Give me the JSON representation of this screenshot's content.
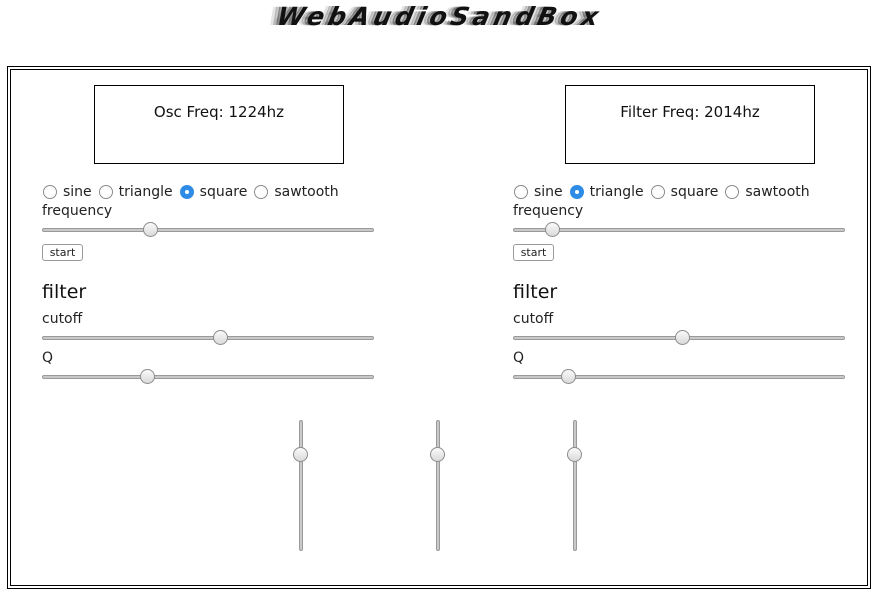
{
  "title": "WebAudioSandBox",
  "left": {
    "display": "Osc Freq: 1224hz",
    "waveforms": [
      {
        "label": "sine",
        "checked": false
      },
      {
        "label": "triangle",
        "checked": false
      },
      {
        "label": "square",
        "checked": true
      },
      {
        "label": "sawtooth",
        "checked": false
      }
    ],
    "frequency_label": "frequency",
    "frequency_value": 0.32,
    "start_label": "start",
    "filter_heading": "filter",
    "cutoff_label": "cutoff",
    "cutoff_value": 0.54,
    "q_label": "Q",
    "q_value": 0.31
  },
  "right": {
    "display": "Filter Freq: 2014hz",
    "waveforms": [
      {
        "label": "sine",
        "checked": false
      },
      {
        "label": "triangle",
        "checked": true
      },
      {
        "label": "square",
        "checked": false
      },
      {
        "label": "sawtooth",
        "checked": false
      }
    ],
    "frequency_label": "frequency",
    "frequency_value": 0.1,
    "start_label": "start",
    "filter_heading": "filter",
    "cutoff_label": "cutoff",
    "cutoff_value": 0.51,
    "q_label": "Q",
    "q_value": 0.15
  },
  "gain_sliders": [
    0.77,
    0.77,
    0.77
  ],
  "colors": {
    "accent": "#2f8ce6",
    "border": "#000000",
    "track": "#c9c9c9"
  }
}
